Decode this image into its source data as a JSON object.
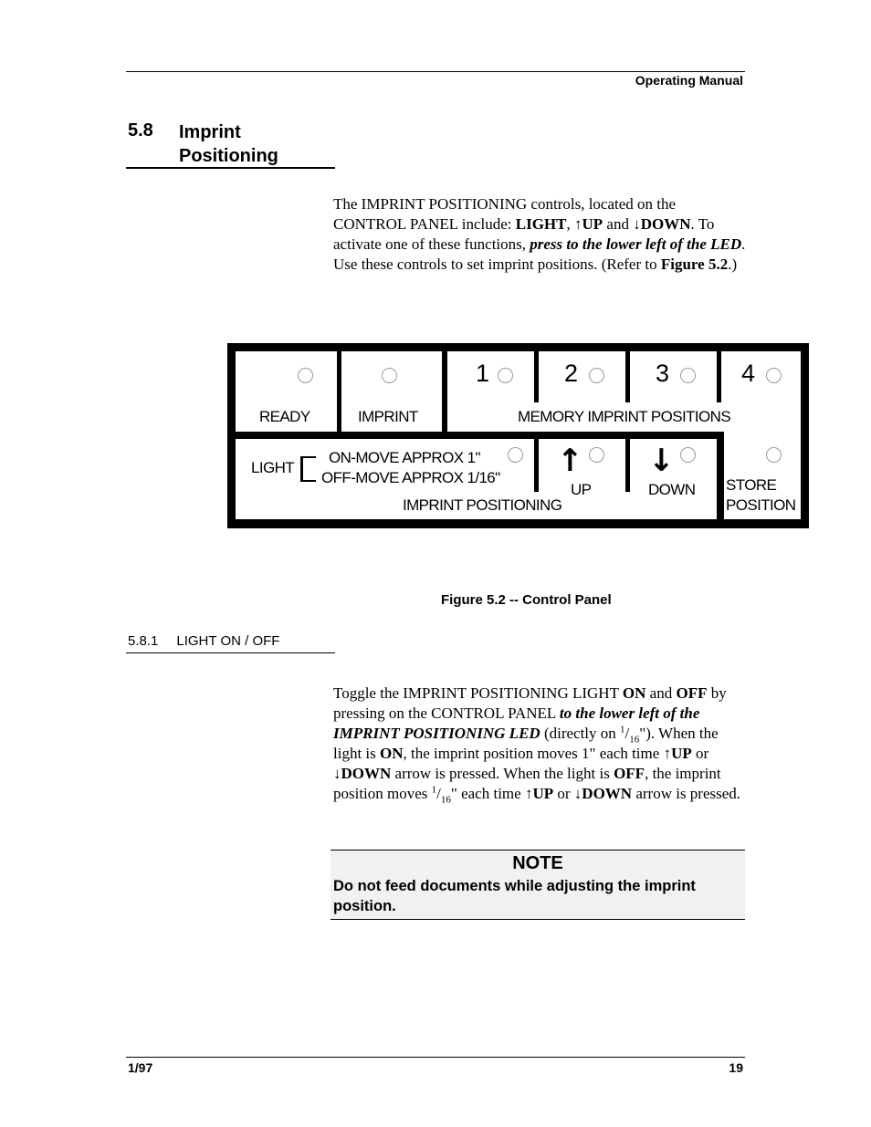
{
  "header": {
    "title": "Operating Manual"
  },
  "section": {
    "number": "5.8",
    "title": "Imprint Positioning"
  },
  "intro": {
    "t1": "The IMPRINT POSITIONING controls, located on the CONTROL PANEL include: ",
    "light": "LIGHT",
    "comma": ", ",
    "up_arrow": "↑",
    "up": "UP",
    "and": " and ",
    "down_arrow": "↓",
    "down": "DOWN",
    "t2": ". To activate one of these functions, ",
    "emph": "press to the lower left of the LED",
    "t3": ". Use these controls to set imprint positions. (Refer to ",
    "fig_ref": "Figure 5.2",
    "t4": ".)"
  },
  "panel": {
    "ready": "READY",
    "imprint": "IMPRINT",
    "mem_numbers": [
      "1",
      "2",
      "3",
      "4"
    ],
    "memory_label": "MEMORY IMPRINT POSITIONS",
    "light": "LIGHT",
    "light_on": "ON-MOVE APPROX 1\"",
    "light_off": "OFF-MOVE APPROX 1/16\"",
    "imprint_positioning": "IMPRINT POSITIONING",
    "up_arrow": "↑",
    "up": "UP",
    "down_arrow": "↓",
    "down": "DOWN",
    "store_1": "STORE",
    "store_2": "POSITION",
    "icons": [
      "led-indicator",
      "arrow-up-icon",
      "arrow-down-icon"
    ]
  },
  "figure_caption": "Figure 5.2 -- Control Panel",
  "subsection": {
    "number": "5.8.1",
    "title": "LIGHT ON / OFF"
  },
  "light_text": {
    "p1": "Toggle the IMPRINT POSITIONING LIGHT ",
    "on": "ON",
    "and": " and ",
    "off": "OFF",
    "p2": " by pressing on the CONTROL PANEL ",
    "emph": "to the lower left of the IMPRINT POSITIONING LED",
    "p3": " (directly on ",
    "frac_num": "1",
    "frac_den": "16",
    "p4": "\"). When the light is ",
    "on2": "ON",
    "p5": ", the imprint position moves 1\" each time ",
    "up_arrow": "↑",
    "up": "UP",
    "or": " or ",
    "down_arrow": "↓",
    "down": "DOWN",
    "p6": " arrow is pressed. When the light is ",
    "off2": "OFF",
    "p7": ", the imprint position moves ",
    "p8": "\" each time ",
    "p9": " arrow is pressed."
  },
  "note": {
    "title": "NOTE",
    "text": "Do not feed documents while adjusting the imprint position."
  },
  "footer": {
    "date": "1/97",
    "page": "19"
  }
}
